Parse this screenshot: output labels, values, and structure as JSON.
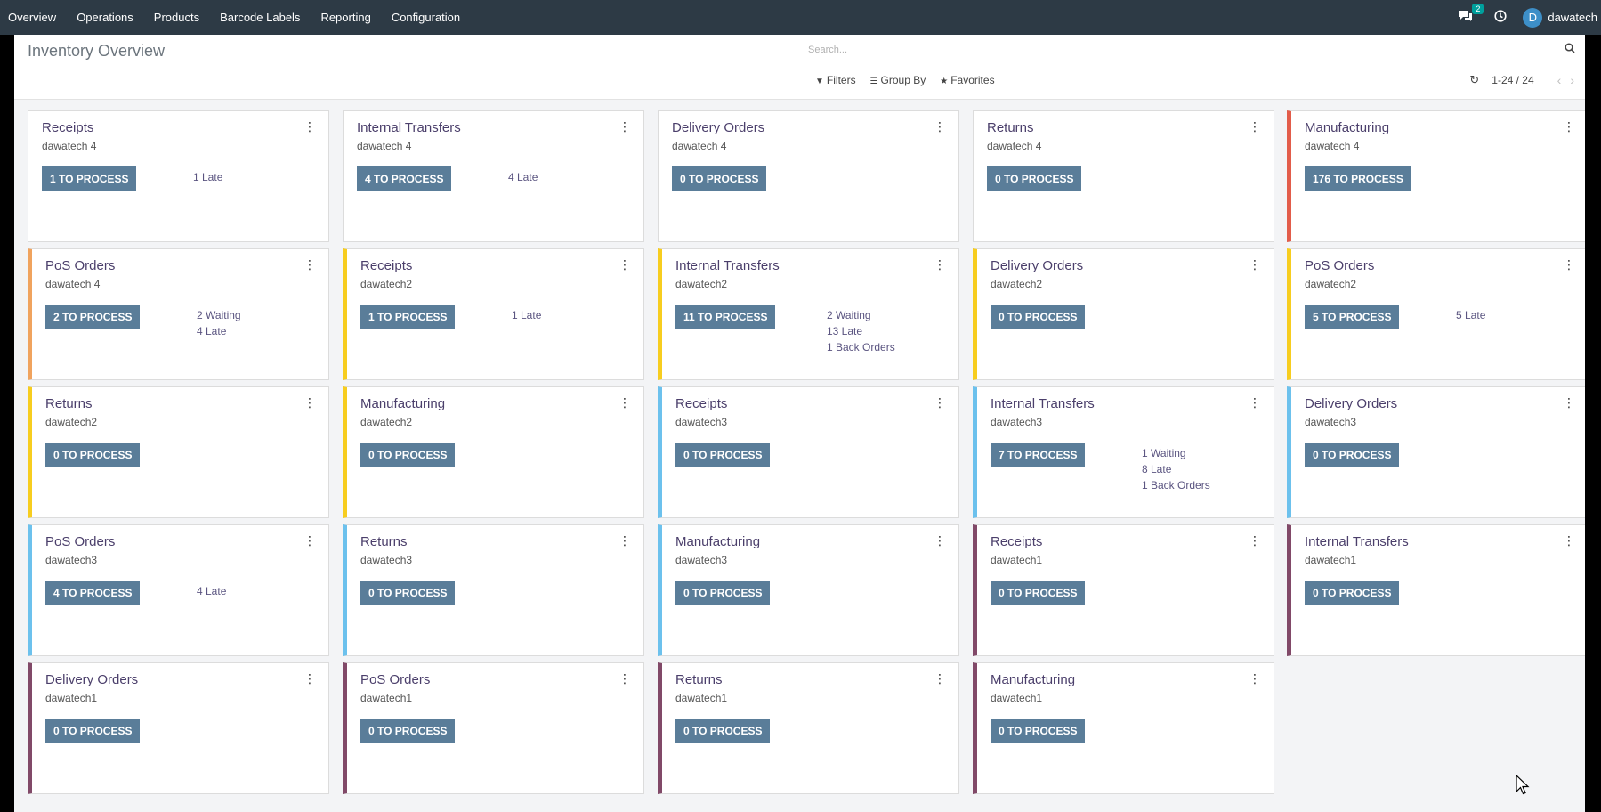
{
  "nav": {
    "menu": [
      "Overview",
      "Operations",
      "Products",
      "Barcode Labels",
      "Reporting",
      "Configuration"
    ],
    "message_count": "2",
    "user_initial": "D",
    "user_name": "dawatech"
  },
  "control": {
    "title": "Inventory Overview",
    "search_placeholder": "Search...",
    "filters": "Filters",
    "group_by": "Group By",
    "favorites": "Favorites",
    "pager": "1-24 / 24"
  },
  "colors": {
    "topbar": "#2d3a45",
    "button": "#5a7d99",
    "red": "#e25c4a",
    "orange": "#f0a35e",
    "yellow": "#f7cd1f",
    "blue": "#6cc1ed",
    "purple": "#814968"
  },
  "cards": [
    {
      "title": "Receipts",
      "warehouse": "dawatech 4",
      "button": "1 TO PROCESS",
      "stats": [
        "1 Late"
      ],
      "color": ""
    },
    {
      "title": "Internal Transfers",
      "warehouse": "dawatech 4",
      "button": "4 TO PROCESS",
      "stats": [
        "4 Late"
      ],
      "color": ""
    },
    {
      "title": "Delivery Orders",
      "warehouse": "dawatech 4",
      "button": "0 TO PROCESS",
      "stats": [],
      "color": ""
    },
    {
      "title": "Returns",
      "warehouse": "dawatech 4",
      "button": "0 TO PROCESS",
      "stats": [],
      "color": ""
    },
    {
      "title": "Manufacturing",
      "warehouse": "dawatech 4",
      "button": "176 TO PROCESS",
      "stats": [],
      "color": "red"
    },
    {
      "title": "PoS Orders",
      "warehouse": "dawatech 4",
      "button": "2 TO PROCESS",
      "stats": [
        "2 Waiting",
        "4 Late"
      ],
      "color": "orange"
    },
    {
      "title": "Receipts",
      "warehouse": "dawatech2",
      "button": "1 TO PROCESS",
      "stats": [
        "1 Late"
      ],
      "color": "yellow"
    },
    {
      "title": "Internal Transfers",
      "warehouse": "dawatech2",
      "button": "11 TO PROCESS",
      "stats": [
        "2 Waiting",
        "13 Late",
        "1 Back Orders"
      ],
      "color": "yellow"
    },
    {
      "title": "Delivery Orders",
      "warehouse": "dawatech2",
      "button": "0 TO PROCESS",
      "stats": [],
      "color": "yellow"
    },
    {
      "title": "PoS Orders",
      "warehouse": "dawatech2",
      "button": "5 TO PROCESS",
      "stats": [
        "5 Late"
      ],
      "color": "yellow"
    },
    {
      "title": "Returns",
      "warehouse": "dawatech2",
      "button": "0 TO PROCESS",
      "stats": [],
      "color": "yellow"
    },
    {
      "title": "Manufacturing",
      "warehouse": "dawatech2",
      "button": "0 TO PROCESS",
      "stats": [],
      "color": "yellow"
    },
    {
      "title": "Receipts",
      "warehouse": "dawatech3",
      "button": "0 TO PROCESS",
      "stats": [],
      "color": "blue"
    },
    {
      "title": "Internal Transfers",
      "warehouse": "dawatech3",
      "button": "7 TO PROCESS",
      "stats": [
        "1 Waiting",
        "8 Late",
        "1 Back Orders"
      ],
      "color": "blue"
    },
    {
      "title": "Delivery Orders",
      "warehouse": "dawatech3",
      "button": "0 TO PROCESS",
      "stats": [],
      "color": "blue"
    },
    {
      "title": "PoS Orders",
      "warehouse": "dawatech3",
      "button": "4 TO PROCESS",
      "stats": [
        "4 Late"
      ],
      "color": "blue"
    },
    {
      "title": "Returns",
      "warehouse": "dawatech3",
      "button": "0 TO PROCESS",
      "stats": [],
      "color": "blue"
    },
    {
      "title": "Manufacturing",
      "warehouse": "dawatech3",
      "button": "0 TO PROCESS",
      "stats": [],
      "color": "blue"
    },
    {
      "title": "Receipts",
      "warehouse": "dawatech1",
      "button": "0 TO PROCESS",
      "stats": [],
      "color": "purple"
    },
    {
      "title": "Internal Transfers",
      "warehouse": "dawatech1",
      "button": "0 TO PROCESS",
      "stats": [],
      "color": "purple"
    },
    {
      "title": "Delivery Orders",
      "warehouse": "dawatech1",
      "button": "0 TO PROCESS",
      "stats": [],
      "color": "purple"
    },
    {
      "title": "PoS Orders",
      "warehouse": "dawatech1",
      "button": "0 TO PROCESS",
      "stats": [],
      "color": "purple"
    },
    {
      "title": "Returns",
      "warehouse": "dawatech1",
      "button": "0 TO PROCESS",
      "stats": [],
      "color": "purple"
    },
    {
      "title": "Manufacturing",
      "warehouse": "dawatech1",
      "button": "0 TO PROCESS",
      "stats": [],
      "color": "purple"
    }
  ]
}
